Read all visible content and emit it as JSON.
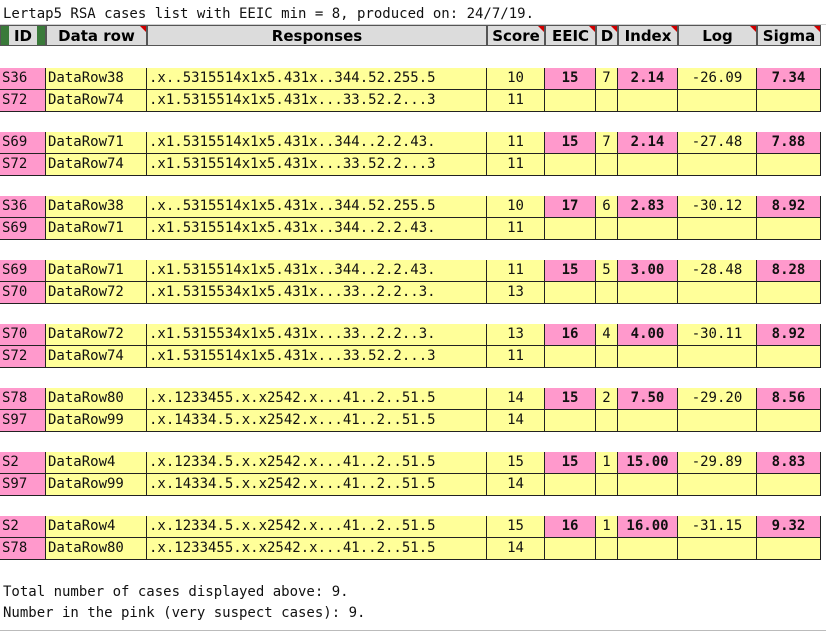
{
  "sheet_title": "Lertap5 RSA cases list with EEIC min = 8, produced on: 24/7/19.",
  "columns": [
    "ID",
    "Data row",
    "Responses",
    "Score",
    "EEIC",
    "D",
    "Index",
    "Log",
    "Sigma"
  ],
  "pairs": [
    {
      "eeic": "15",
      "d": "7",
      "index": "2.14",
      "log": "-26.09",
      "sigma": "7.34",
      "rows": [
        {
          "id": "S36",
          "data_row": "DataRow38",
          "responses": ".x..5315514x1x5.431x..344.52.255.5",
          "score": "10"
        },
        {
          "id": "S72",
          "data_row": "DataRow74",
          "responses": ".x1.5315514x1x5.431x...33.52.2...3",
          "score": "11"
        }
      ]
    },
    {
      "eeic": "15",
      "d": "7",
      "index": "2.14",
      "log": "-27.48",
      "sigma": "7.88",
      "rows": [
        {
          "id": "S69",
          "data_row": "DataRow71",
          "responses": ".x1.5315514x1x5.431x..344..2.2.43.",
          "score": "11"
        },
        {
          "id": "S72",
          "data_row": "DataRow74",
          "responses": ".x1.5315514x1x5.431x...33.52.2...3",
          "score": "11"
        }
      ]
    },
    {
      "eeic": "17",
      "d": "6",
      "index": "2.83",
      "log": "-30.12",
      "sigma": "8.92",
      "rows": [
        {
          "id": "S36",
          "data_row": "DataRow38",
          "responses": ".x..5315514x1x5.431x..344.52.255.5",
          "score": "10"
        },
        {
          "id": "S69",
          "data_row": "DataRow71",
          "responses": ".x1.5315514x1x5.431x..344..2.2.43.",
          "score": "11"
        }
      ]
    },
    {
      "eeic": "15",
      "d": "5",
      "index": "3.00",
      "log": "-28.48",
      "sigma": "8.28",
      "rows": [
        {
          "id": "S69",
          "data_row": "DataRow71",
          "responses": ".x1.5315514x1x5.431x..344..2.2.43.",
          "score": "11"
        },
        {
          "id": "S70",
          "data_row": "DataRow72",
          "responses": ".x1.5315534x1x5.431x...33..2.2..3.",
          "score": "13"
        }
      ]
    },
    {
      "eeic": "16",
      "d": "4",
      "index": "4.00",
      "log": "-30.11",
      "sigma": "8.92",
      "rows": [
        {
          "id": "S70",
          "data_row": "DataRow72",
          "responses": ".x1.5315534x1x5.431x...33..2.2..3.",
          "score": "13"
        },
        {
          "id": "S72",
          "data_row": "DataRow74",
          "responses": ".x1.5315514x1x5.431x...33.52.2...3",
          "score": "11"
        }
      ]
    },
    {
      "eeic": "15",
      "d": "2",
      "index": "7.50",
      "log": "-29.20",
      "sigma": "8.56",
      "rows": [
        {
          "id": "S78",
          "data_row": "DataRow80",
          "responses": ".x.1233455.x.x2542.x...41..2..51.5",
          "score": "14"
        },
        {
          "id": "S97",
          "data_row": "DataRow99",
          "responses": ".x.14334.5.x.x2542.x...41..2..51.5",
          "score": "14"
        }
      ]
    },
    {
      "eeic": "15",
      "d": "1",
      "index": "15.00",
      "log": "-29.89",
      "sigma": "8.83",
      "rows": [
        {
          "id": "S2",
          "data_row": "DataRow4",
          "responses": ".x.12334.5.x.x2542.x...41..2..51.5",
          "score": "15"
        },
        {
          "id": "S97",
          "data_row": "DataRow99",
          "responses": ".x.14334.5.x.x2542.x...41..2..51.5",
          "score": "14"
        }
      ]
    },
    {
      "eeic": "16",
      "d": "1",
      "index": "16.00",
      "log": "-31.15",
      "sigma": "9.32",
      "rows": [
        {
          "id": "S2",
          "data_row": "DataRow4",
          "responses": ".x.12334.5.x.x2542.x...41..2..51.5",
          "score": "15"
        },
        {
          "id": "S78",
          "data_row": "DataRow80",
          "responses": ".x.1233455.x.x2542.x...41..2..51.5",
          "score": "14"
        }
      ]
    }
  ],
  "footer": {
    "total": "Total number of cases displayed above: 9.",
    "pink": "Number in the pink (very suspect cases): 9."
  },
  "colors": {
    "pink": "#ff99cc",
    "yellow": "#ffff99",
    "header": "#dcdcdc",
    "comment_marker": "#d00000"
  }
}
